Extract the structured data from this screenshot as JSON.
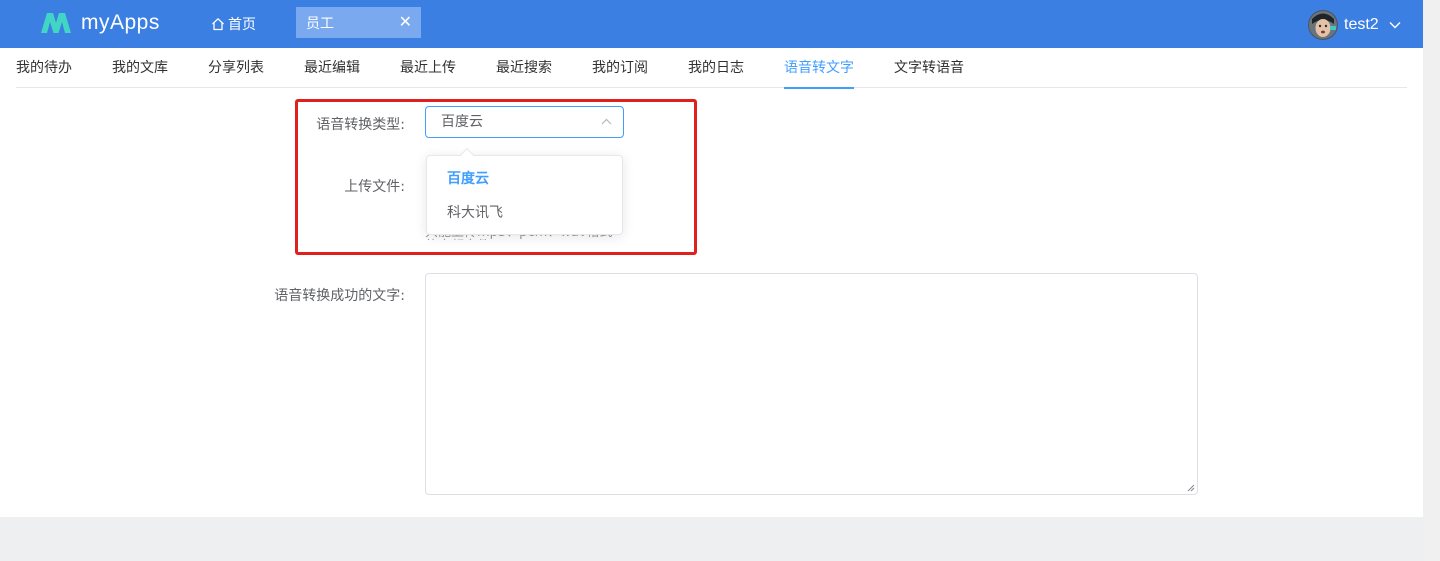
{
  "app": {
    "name": "myApps"
  },
  "topbar": {
    "home_label": "首页",
    "open_tab": {
      "label": "员工",
      "close_glyph": "✕"
    },
    "user": {
      "name": "test2"
    }
  },
  "nav": {
    "tabs": [
      {
        "label": "我的待办",
        "active": false
      },
      {
        "label": "我的文库",
        "active": false
      },
      {
        "label": "分享列表",
        "active": false
      },
      {
        "label": "最近编辑",
        "active": false
      },
      {
        "label": "最近上传",
        "active": false
      },
      {
        "label": "最近搜索",
        "active": false
      },
      {
        "label": "我的订阅",
        "active": false
      },
      {
        "label": "我的日志",
        "active": false
      },
      {
        "label": "语音转文字",
        "active": true
      },
      {
        "label": "文字转语音",
        "active": false
      }
    ]
  },
  "form": {
    "type_label": "语音转换类型:",
    "type_value": "百度云",
    "type_options": [
      {
        "label": "百度云",
        "selected": true
      },
      {
        "label": "科大讯飞",
        "selected": false
      }
    ],
    "upload_label": "上传文件:",
    "upload_hint": "只能上传mp3、pcm、wav格式的音频文件",
    "result_label": "语音转换成功的文字:",
    "result_value": ""
  },
  "colors": {
    "header": "#3b7fe3",
    "accent": "#409eff",
    "highlight": "#e0201c"
  }
}
